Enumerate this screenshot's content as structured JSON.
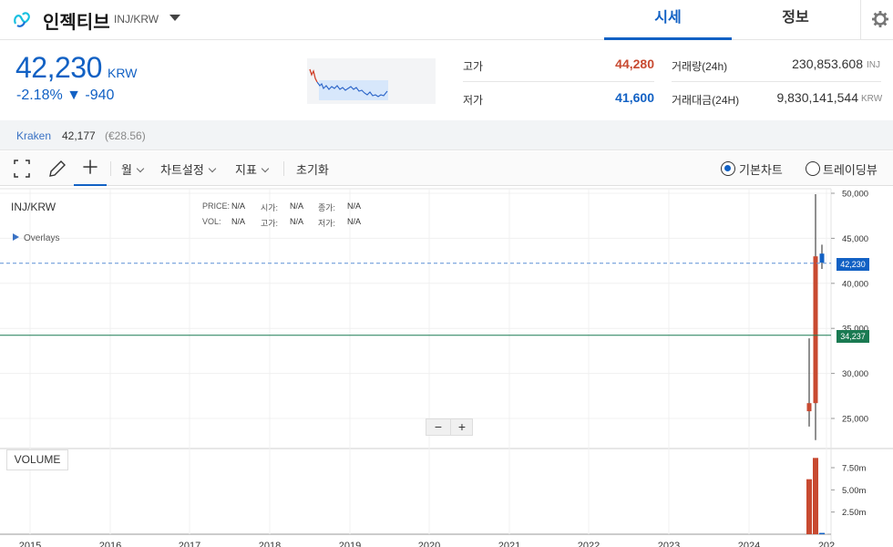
{
  "header": {
    "coin_name": "인젝티브",
    "pair": "INJ/KRW",
    "tabs": [
      {
        "label": "시세",
        "active": true
      },
      {
        "label": "정보",
        "active": false
      }
    ]
  },
  "summary": {
    "price": "42,230",
    "unit": "KRW",
    "change": "-2.18% ▼ -940",
    "high_label": "고가",
    "high_value": "44,280",
    "low_label": "저가",
    "low_value": "41,600",
    "volume_label": "거래량(24h)",
    "volume_value": "230,853.608",
    "volume_unit": "INJ",
    "amount_label": "거래대금(24H)",
    "amount_value": "9,830,141,544",
    "amount_unit": "KRW"
  },
  "exchange": {
    "name": "Kraken",
    "price": "42,177",
    "eur": "(€28.56)"
  },
  "toolbar": {
    "period_label": "월",
    "chart_settings_label": "차트설정",
    "indicator_label": "지표",
    "reset_label": "초기화",
    "view_basic_label": "기본차트",
    "view_trading_label": "트레이딩뷰",
    "selected_view": "기본차트"
  },
  "chart": {
    "symbol": "INJ/KRW",
    "overlays_label": "Overlays",
    "legend": {
      "price_label": "PRICE:",
      "price": "N/A",
      "open_label": "시가:",
      "open": "N/A",
      "close_label": "종가:",
      "close": "N/A",
      "vol_label": "VOL:",
      "vol": "N/A",
      "high_label": "고가:",
      "high": "N/A",
      "low_label": "저가:",
      "low": "N/A"
    },
    "current_tag": "42,230",
    "line_tag": "34,237",
    "volume_label": "VOLUME",
    "zoom_out": "−",
    "zoom_in": "+"
  },
  "colors": {
    "accent_blue": "#1261c4",
    "up_red": "#c84a31",
    "green_line": "#1a7a52"
  },
  "chart_data": {
    "type": "candlestick",
    "price_axis": {
      "ticks": [
        "50,000",
        "45,000",
        "40,000",
        "35,000",
        "30,000",
        "25,000"
      ],
      "values": [
        50000,
        45000,
        40000,
        35000,
        30000,
        25000
      ]
    },
    "volume_axis": {
      "ticks": [
        "7.50m",
        "5.00m",
        "2.50m"
      ],
      "values": [
        7500000,
        5000000,
        2500000
      ]
    },
    "x_axis": {
      "ticks": [
        "2015",
        "2016",
        "2017",
        "2018",
        "2019",
        "2020",
        "2021",
        "2022",
        "2023",
        "2024",
        "202"
      ]
    },
    "current_price": 42230,
    "horizontal_line": 34237,
    "candles": [
      {
        "open": 25800,
        "close": 26700,
        "high": 33900,
        "low": 24100,
        "color": "up"
      },
      {
        "open": 26700,
        "close": 43000,
        "high": 49900,
        "low": 22600,
        "color": "up"
      },
      {
        "open": 42300,
        "close": 43300,
        "high": 44300,
        "low": 41600,
        "color": "down"
      }
    ],
    "volumes": [
      6200000,
      8600000,
      150000
    ]
  }
}
